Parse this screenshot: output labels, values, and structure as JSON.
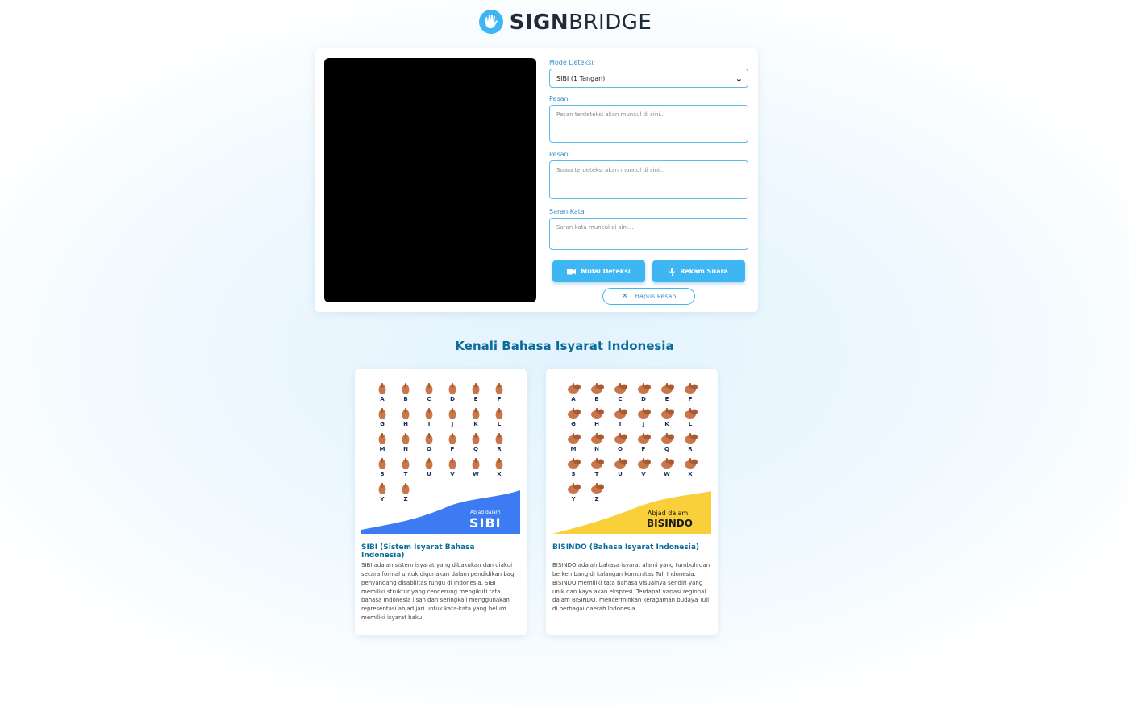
{
  "brand": {
    "bold": "SIGN",
    "light": "BRIDGE",
    "logo_icon": "hand-chat-icon"
  },
  "detector": {
    "mode_label": "Mode Deteksi:",
    "mode_value": "SIBI (1 Tangan)",
    "message_label": "Pesan:",
    "message_placeholder": "Pesan terdeteksi akan muncul di sini...",
    "voice_label": "Pesan:",
    "voice_placeholder": "Suara terdeteksi akan muncul di sini...",
    "suggest_label": "Saran Kata",
    "suggest_placeholder": "Saran kata muncul di sini...",
    "start_button": "Mulai Deteksi",
    "record_button": "Rekam Suara",
    "clear_button": "Hapus Pesan"
  },
  "section": {
    "title": "Kenali Bahasa Isyarat Indonesia"
  },
  "cards": [
    {
      "title": "SIBI (Sistem Isyarat Bahasa Indonesia)",
      "desc": "SIBI adalah sistem isyarat yang dibakukan dan diakui secara formal untuk digunakan dalam pendidikan bagi penyandang disabilitas rungu di Indonesia. SIBI memiliki struktur yang cenderung mengikuti tata bahasa Indonesia lisan dan seringkali menggunakan representasi abjad jari untuk kata-kata yang belum memiliki isyarat baku.",
      "banner_small": "Abjad dalam",
      "banner_big": "SIBI",
      "accent": "#3d7bf2"
    },
    {
      "title": "BISINDO (Bahasa Isyarat Indonesia)",
      "desc": "BISINDO adalah bahasa isyarat alami yang tumbuh dan berkembang di kalangan komunitas Tuli Indonesia. BISINDO memiliki tata bahasa visualnya sendiri yang unik dan kaya akan ekspresi. Terdapat variasi regional dalam BISINDO, mencerminkan keragaman budaya Tuli di berbagai daerah Indonesia.",
      "banner_small": "Abjad dalam",
      "banner_big": "BISINDO",
      "accent": "#f9cf3a"
    }
  ],
  "alphabet": [
    "A",
    "B",
    "C",
    "D",
    "E",
    "F",
    "G",
    "H",
    "I",
    "J",
    "K",
    "L",
    "M",
    "N",
    "O",
    "P",
    "Q",
    "R",
    "S",
    "T",
    "U",
    "V",
    "W",
    "X",
    "Y",
    "Z"
  ]
}
